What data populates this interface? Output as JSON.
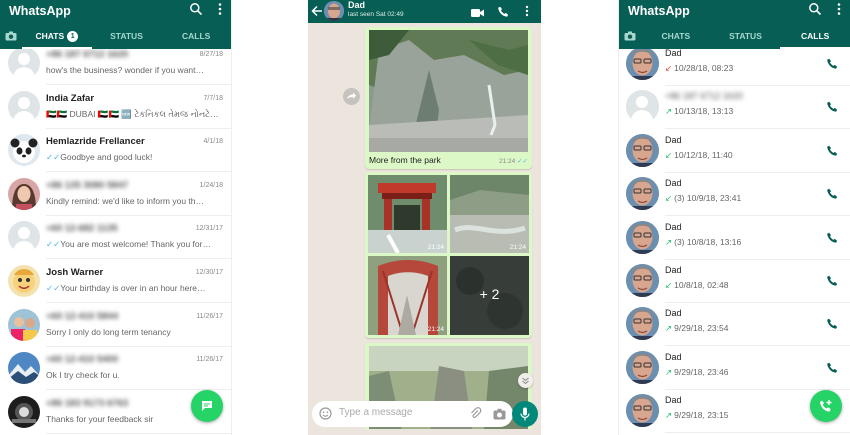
{
  "chats_screen": {
    "title": "WhatsApp",
    "tabs": {
      "chats": "CHATS",
      "chats_badge": "1",
      "status": "STATUS",
      "calls": "CALLS"
    },
    "rows": [
      {
        "name": "+86 187 6712 1620",
        "name_blurred": true,
        "date": "8/27/18",
        "message": "how's the business? wonder if you want…",
        "tick": false,
        "avatar": "default"
      },
      {
        "name": "India Zafar",
        "name_blurred": false,
        "date": "7/7/18",
        "message": "🇦🇪🇦🇪 DUBAI 🇦🇪🇦🇪 🆕 ટેકનિકલ તેમજ નોનટે…",
        "tick": false,
        "avatar": "default"
      },
      {
        "name": "Hemlazride Frellancer",
        "name_blurred": false,
        "date": "4/1/18",
        "message": "Goodbye and good luck!",
        "tick": true,
        "avatar": "panda"
      },
      {
        "name": "+86 135 3080 5847",
        "name_blurred": true,
        "date": "1/24/18",
        "message": "Kindly remind: we'd like to inform you th…",
        "tick": false,
        "avatar": "woman"
      },
      {
        "name": "+60 12-682 1135",
        "name_blurred": true,
        "date": "12/31/17",
        "message": "You are most welcome! Thank you for…",
        "tick": true,
        "avatar": "default"
      },
      {
        "name": "Josh Warner",
        "name_blurred": false,
        "date": "12/30/17",
        "message": "Your birthday is over in an hour here…",
        "tick": true,
        "avatar": "cartoon"
      },
      {
        "name": "+60 12-410 5844",
        "name_blurred": true,
        "date": "11/26/17",
        "message": "Sorry I only do long term tenancy",
        "tick": false,
        "avatar": "people"
      },
      {
        "name": "+60 12-410 5400",
        "name_blurred": true,
        "date": "11/26/17",
        "message": "Ok I try check for u.",
        "tick": false,
        "avatar": "mountain"
      },
      {
        "name": "+86 183 9173 6763",
        "name_blurred": true,
        "date": "",
        "message": "Thanks for your feedback sir",
        "tick": false,
        "avatar": "dark"
      }
    ]
  },
  "chat_screen": {
    "contact": "Dad",
    "status": "last seen Sat 02:49",
    "caption": "More from the park",
    "caption_time": "21:24",
    "grid_times": [
      "21:24",
      "21:24",
      "21:24"
    ],
    "more_count": "+ 2",
    "input_placeholder": "Type a message"
  },
  "calls_screen": {
    "title": "WhatsApp",
    "tabs": {
      "chats": "CHATS",
      "status": "STATUS",
      "calls": "CALLS"
    },
    "rows": [
      {
        "name": "Dad",
        "name_blurred": false,
        "direction": "in",
        "arrow": "↙",
        "info": "10/28/18, 08:23",
        "avatar": "dad"
      },
      {
        "name": "+86 187 6712 1620",
        "name_blurred": true,
        "direction": "out",
        "arrow": "↗",
        "info": "10/13/18, 13:13",
        "avatar": "default"
      },
      {
        "name": "Dad",
        "name_blurred": false,
        "direction": "in-ok",
        "arrow": "↙",
        "info": "10/12/18, 11:40",
        "avatar": "dad"
      },
      {
        "name": "Dad",
        "name_blurred": false,
        "direction": "in-ok",
        "arrow": "↙",
        "info": "(3)  10/9/18, 23:41",
        "avatar": "dad"
      },
      {
        "name": "Dad",
        "name_blurred": false,
        "direction": "out",
        "arrow": "↗",
        "info": "(3)  10/8/18, 13:16",
        "avatar": "dad"
      },
      {
        "name": "Dad",
        "name_blurred": false,
        "direction": "in-ok",
        "arrow": "↙",
        "info": "10/8/18, 02:48",
        "avatar": "dad"
      },
      {
        "name": "Dad",
        "name_blurred": false,
        "direction": "out",
        "arrow": "↗",
        "info": "9/29/18, 23:54",
        "avatar": "dad"
      },
      {
        "name": "Dad",
        "name_blurred": false,
        "direction": "out",
        "arrow": "↗",
        "info": "9/29/18, 23:46",
        "avatar": "dad"
      },
      {
        "name": "Dad",
        "name_blurred": false,
        "direction": "out",
        "arrow": "↗",
        "info": "9/29/18, 23:15",
        "avatar": "dad"
      }
    ]
  },
  "colors": {
    "header": "#075e54",
    "accent": "#25d366",
    "bubble": "#dcf8c6",
    "chat_bg": "#ece5dd",
    "tick": "#4fb6ec",
    "missed": "#e0473b",
    "outgoing": "#25c26e"
  },
  "icons": [
    "search-icon",
    "menu-dots-icon",
    "camera-icon",
    "back-arrow-icon",
    "video-call-icon",
    "phone-icon",
    "emoji-icon",
    "attach-icon",
    "camera-small-icon",
    "mic-icon",
    "new-chat-icon",
    "new-call-icon",
    "forward-icon",
    "scroll-down-icon"
  ]
}
